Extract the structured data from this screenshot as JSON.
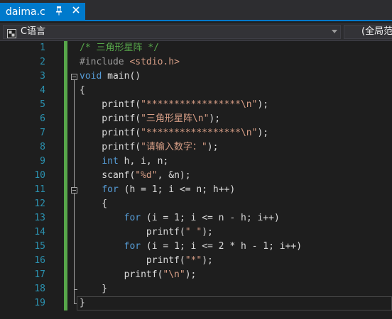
{
  "tab": {
    "title": "daima.c",
    "pin_icon": "pin-icon",
    "close_icon": "close-icon"
  },
  "navbar": {
    "scope": "C语言",
    "member": "(全局范"
  },
  "colors": {
    "accent": "#007acc",
    "line_number": "#2b91af",
    "comment": "#57a64a",
    "keyword": "#569cd6",
    "string": "#d69d85",
    "preprocessor": "#9b9b9b",
    "text": "#dcdcdc",
    "background": "#1e1e1e"
  },
  "editor": {
    "line_numbers": [
      "1",
      "2",
      "3",
      "4",
      "5",
      "6",
      "7",
      "8",
      "9",
      "10",
      "11",
      "12",
      "13",
      "14",
      "15",
      "16",
      "17",
      "18",
      "19"
    ],
    "lines": [
      {
        "tokens": [
          {
            "t": "/* 三角形星阵 */",
            "k": "comment"
          }
        ]
      },
      {
        "tokens": [
          {
            "t": "#include ",
            "k": "pre"
          },
          {
            "t": "<stdio.h>",
            "k": "header"
          }
        ]
      },
      {
        "tokens": [
          {
            "t": "void",
            "k": "kw"
          },
          {
            "t": " main()",
            "k": "plain"
          }
        ]
      },
      {
        "tokens": [
          {
            "t": "{",
            "k": "plain"
          }
        ]
      },
      {
        "tokens": [
          {
            "t": "    printf(",
            "k": "plain"
          },
          {
            "t": "\"*****************\\n\"",
            "k": "str"
          },
          {
            "t": ");",
            "k": "plain"
          }
        ]
      },
      {
        "tokens": [
          {
            "t": "    printf(",
            "k": "plain"
          },
          {
            "t": "\"三角形星阵\\n\"",
            "k": "str"
          },
          {
            "t": ");",
            "k": "plain"
          }
        ]
      },
      {
        "tokens": [
          {
            "t": "    printf(",
            "k": "plain"
          },
          {
            "t": "\"*****************\\n\"",
            "k": "str"
          },
          {
            "t": ");",
            "k": "plain"
          }
        ]
      },
      {
        "tokens": [
          {
            "t": "    printf(",
            "k": "plain"
          },
          {
            "t": "\"请输入数字：\"",
            "k": "str"
          },
          {
            "t": ");",
            "k": "plain"
          }
        ]
      },
      {
        "tokens": [
          {
            "t": "    ",
            "k": "plain"
          },
          {
            "t": "int",
            "k": "kw"
          },
          {
            "t": " h, i, n;",
            "k": "plain"
          }
        ]
      },
      {
        "tokens": [
          {
            "t": "    scanf(",
            "k": "plain"
          },
          {
            "t": "\"%d\"",
            "k": "str"
          },
          {
            "t": ", &n);",
            "k": "plain"
          }
        ]
      },
      {
        "tokens": [
          {
            "t": "    ",
            "k": "plain"
          },
          {
            "t": "for",
            "k": "kw"
          },
          {
            "t": " (h = 1; i <= n; h++)",
            "k": "plain"
          }
        ]
      },
      {
        "tokens": [
          {
            "t": "    {",
            "k": "plain"
          }
        ]
      },
      {
        "tokens": [
          {
            "t": "        ",
            "k": "plain"
          },
          {
            "t": "for",
            "k": "kw"
          },
          {
            "t": " (i = 1; i <= n - h; i++)",
            "k": "plain"
          }
        ]
      },
      {
        "tokens": [
          {
            "t": "            printf(",
            "k": "plain"
          },
          {
            "t": "\" \"",
            "k": "str"
          },
          {
            "t": ");",
            "k": "plain"
          }
        ]
      },
      {
        "tokens": [
          {
            "t": "        ",
            "k": "plain"
          },
          {
            "t": "for",
            "k": "kw"
          },
          {
            "t": " (i = 1; i <= 2 * h - 1; i++)",
            "k": "plain"
          }
        ]
      },
      {
        "tokens": [
          {
            "t": "            printf(",
            "k": "plain"
          },
          {
            "t": "\"*\"",
            "k": "str"
          },
          {
            "t": ");",
            "k": "plain"
          }
        ]
      },
      {
        "tokens": [
          {
            "t": "        printf(",
            "k": "plain"
          },
          {
            "t": "\"\\n\"",
            "k": "str"
          },
          {
            "t": ");",
            "k": "plain"
          }
        ]
      },
      {
        "tokens": [
          {
            "t": "    }",
            "k": "plain"
          }
        ]
      },
      {
        "tokens": [
          {
            "t": "}",
            "k": "plain"
          }
        ]
      }
    ]
  }
}
